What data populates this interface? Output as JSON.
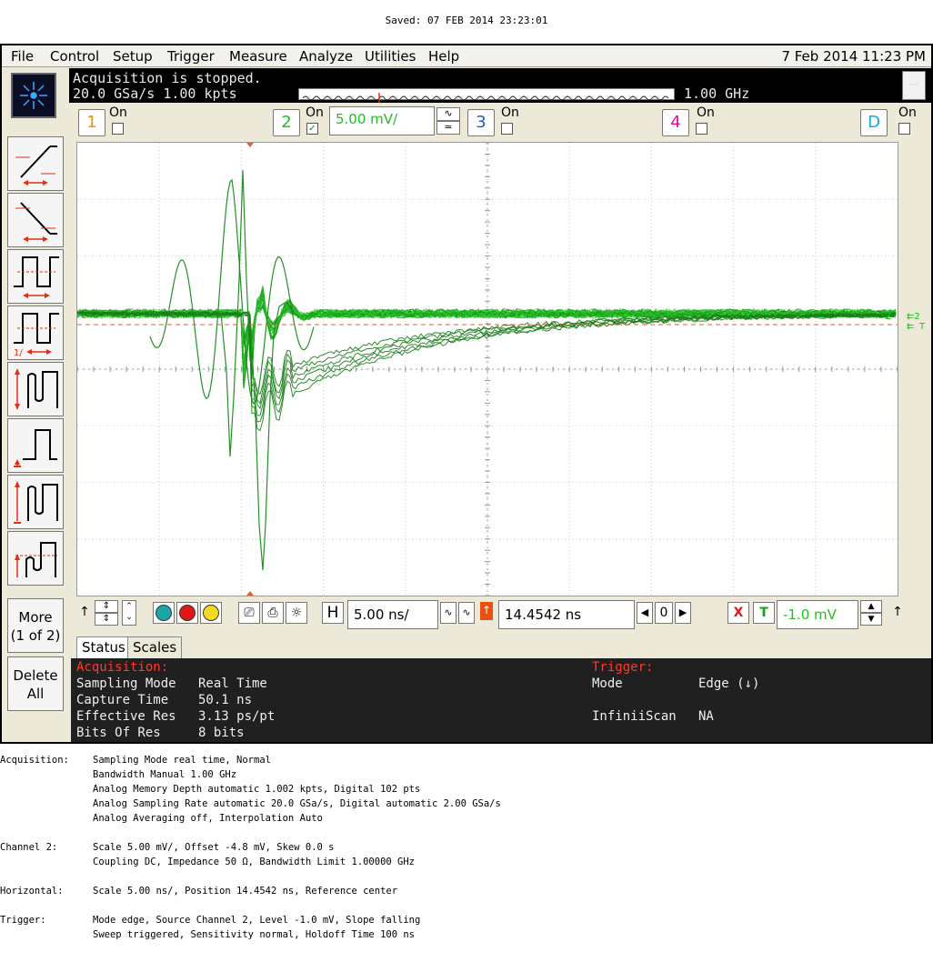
{
  "saved_line": "Saved: 07 FEB 2014 23:23:01",
  "menu": {
    "items": [
      "File",
      "Control",
      "Setup",
      "Trigger",
      "Measure",
      "Analyze",
      "Utilities",
      "Help"
    ],
    "datetime": "7 Feb 2014 11:23 PM"
  },
  "status_bar": {
    "acquisition_state": "Acquisition is stopped.",
    "rate": "20.0 GSa/s  1.00 kpts",
    "bandwidth": "1.00 GHz",
    "minimize_label": "—"
  },
  "channels": [
    {
      "num": "1",
      "on_label": "On",
      "checked": false,
      "color": "#ff8c00"
    },
    {
      "num": "2",
      "on_label": "On",
      "checked": true,
      "color": "#1fbf1f",
      "scale": "5.00 mV/"
    },
    {
      "num": "3",
      "on_label": "On",
      "checked": false,
      "color": "#1a5dc8"
    },
    {
      "num": "4",
      "on_label": "On",
      "checked": false,
      "color": "#e01090"
    },
    {
      "num": "D",
      "on_label": "On",
      "checked": false,
      "color": "#12a8e0"
    }
  ],
  "left_panel": {
    "more_label": "More",
    "more_sub": "(1 of 2)",
    "delete_label": "Delete",
    "delete_sub": "All"
  },
  "waveform": {
    "channel_marker": "2",
    "trigger_marker": "T",
    "trace_color": "#1a9e1a"
  },
  "controls": {
    "h_label": "H",
    "timebase": "5.00 ns/",
    "position": "14.4542 ns",
    "ref_value": "0",
    "trigger_level": "-1.0 mV",
    "x_label": "X",
    "t_label": "T"
  },
  "tabs": [
    "Status",
    "Scales"
  ],
  "status_panel": {
    "acq_header": "Acquisition:",
    "rows": [
      {
        "label": "Sampling Mode",
        "value": "Real Time"
      },
      {
        "label": "Capture Time",
        "value": "50.1 ns"
      },
      {
        "label": "Effective Res",
        "value": "3.13 ps/pt"
      },
      {
        "label": "Bits Of Res",
        "value": "8 bits"
      }
    ],
    "trig_header": "Trigger:",
    "trig_rows": [
      {
        "label": "Mode",
        "value": "Edge (↓)"
      },
      {
        "label": "InfiniiScan",
        "value": "NA"
      }
    ]
  },
  "summary": [
    {
      "label": "Acquisition:",
      "lines": [
        "Sampling Mode real time, Normal",
        "Bandwidth Manual 1.00 GHz",
        "Analog Memory Depth automatic 1.002 kpts, Digital 102 pts",
        "Analog Sampling Rate automatic 20.0 GSa/s, Digital automatic 2.00 GSa/s",
        "Analog Averaging off, Interpolation Auto"
      ]
    },
    {
      "label": "Channel 2:",
      "lines": [
        "Scale 5.00 mV/, Offset -4.8 mV, Skew 0.0 s",
        "Coupling DC, Impedance 50 Ω, Bandwidth Limit 1.00000 GHz"
      ]
    },
    {
      "label": "Horizontal:",
      "lines": [
        "Scale 5.00 ns/, Position 14.4542 ns, Reference center"
      ]
    },
    {
      "label": "Trigger:",
      "lines": [
        "Mode edge, Source Channel 2, Level -1.0 mV, Slope falling",
        "Sweep triggered, Sensitivity normal, Holdoff Time 100 ns"
      ]
    }
  ]
}
